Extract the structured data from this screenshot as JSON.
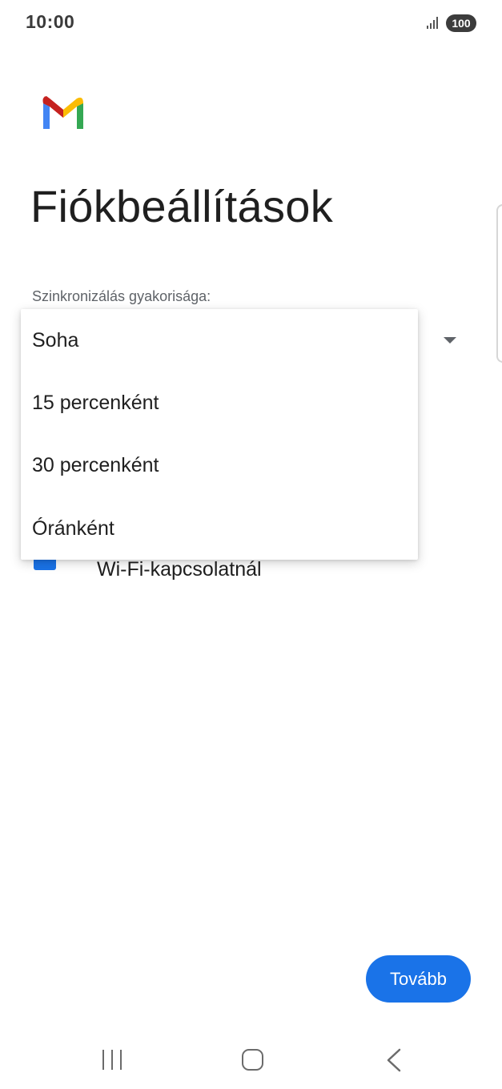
{
  "status_bar": {
    "time": "10:00",
    "battery": "100",
    "signal_icon": "signal-bars-icon"
  },
  "app": {
    "logo": "gmail-logo-icon",
    "title": "Fiókbeállítások"
  },
  "sync": {
    "label": "Szinkronizálás gyakorisága:",
    "options": [
      "Soha",
      "15 percenként",
      "30 percenként",
      "Óránként"
    ]
  },
  "checkbox": {
    "label": "Wi-Fi-kapcsolatnál",
    "checked": true
  },
  "actions": {
    "next_label": "Tovább"
  },
  "colors": {
    "accent": "#1a73e8"
  },
  "nav": {
    "recents_icon": "recents-icon",
    "home_icon": "home-icon",
    "back_icon": "back-icon"
  }
}
